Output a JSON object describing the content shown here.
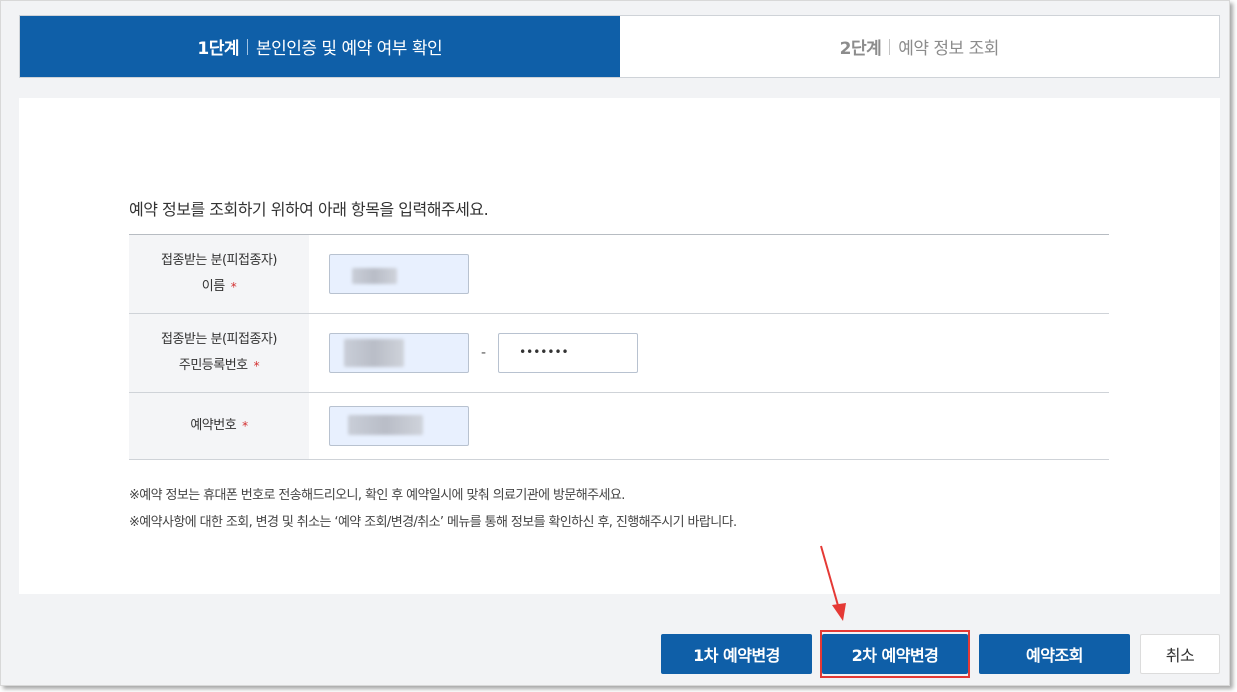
{
  "steps": [
    {
      "num": "1단계",
      "label": "본인인증 및 예약 여부 확인",
      "active": true
    },
    {
      "num": "2단계",
      "label": "예약 정보 조회",
      "active": false
    }
  ],
  "form": {
    "instruction": "예약 정보를 조회하기 위하여 아래 항목을 입력해주세요.",
    "name_label_line1": "접종받는 분(피접종자)",
    "name_label_line2": "이름",
    "rrn_label_line1": "접종받는 분(피접종자)",
    "rrn_label_line2": "주민등록번호",
    "rrn_separator": "-",
    "rrn_back_masked": "•••••••",
    "reservation_label": "예약번호",
    "required_mark": "*"
  },
  "notes": [
    "※예약 정보는 휴대폰 번호로 전송해드리오니, 확인 후 예약일시에 맞춰 의료기관에 방문해주세요.",
    "※예약사항에 대한 조회, 변경 및 취소는 ‘예약 조회/변경/취소’ 메뉴를 통해 정보를 확인하신 후, 진행해주시기 바랍니다."
  ],
  "buttons": {
    "change1": "1차 예약변경",
    "change2": "2차 예약변경",
    "inquiry": "예약조회",
    "cancel": "취소"
  },
  "colors": {
    "primary": "#0f5fa8",
    "highlight": "#e53935",
    "required": "#d32f2f"
  }
}
